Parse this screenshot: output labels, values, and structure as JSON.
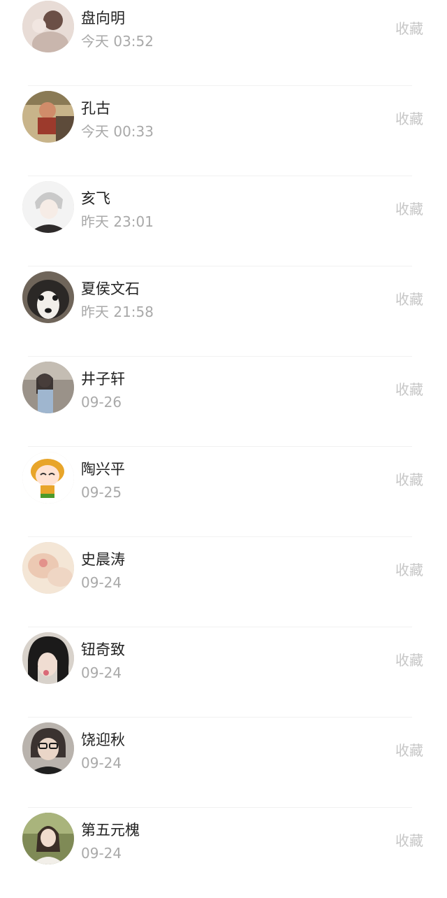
{
  "contacts": [
    {
      "name": "盘向明",
      "time": "今天 03:52",
      "action": "收藏"
    },
    {
      "name": "孔古",
      "time": "今天 00:33",
      "action": "收藏"
    },
    {
      "name": "亥飞",
      "time": "昨天 23:01",
      "action": "收藏"
    },
    {
      "name": "夏侯文石",
      "time": "昨天 21:58",
      "action": "收藏"
    },
    {
      "name": "井子轩",
      "time": "09-26",
      "action": "收藏"
    },
    {
      "name": "陶兴平",
      "time": "09-25",
      "action": "收藏"
    },
    {
      "name": "史晨涛",
      "time": "09-24",
      "action": "收藏"
    },
    {
      "name": "钮奇致",
      "time": "09-24",
      "action": "收藏"
    },
    {
      "name": "饶迎秋",
      "time": "09-24",
      "action": "收藏"
    },
    {
      "name": "第五元槐",
      "time": "09-24",
      "action": "收藏"
    }
  ],
  "colors": {
    "name": "#222222",
    "time": "#a9a9a9",
    "action": "#c6c6c6",
    "divider": "#f1f1f1"
  }
}
